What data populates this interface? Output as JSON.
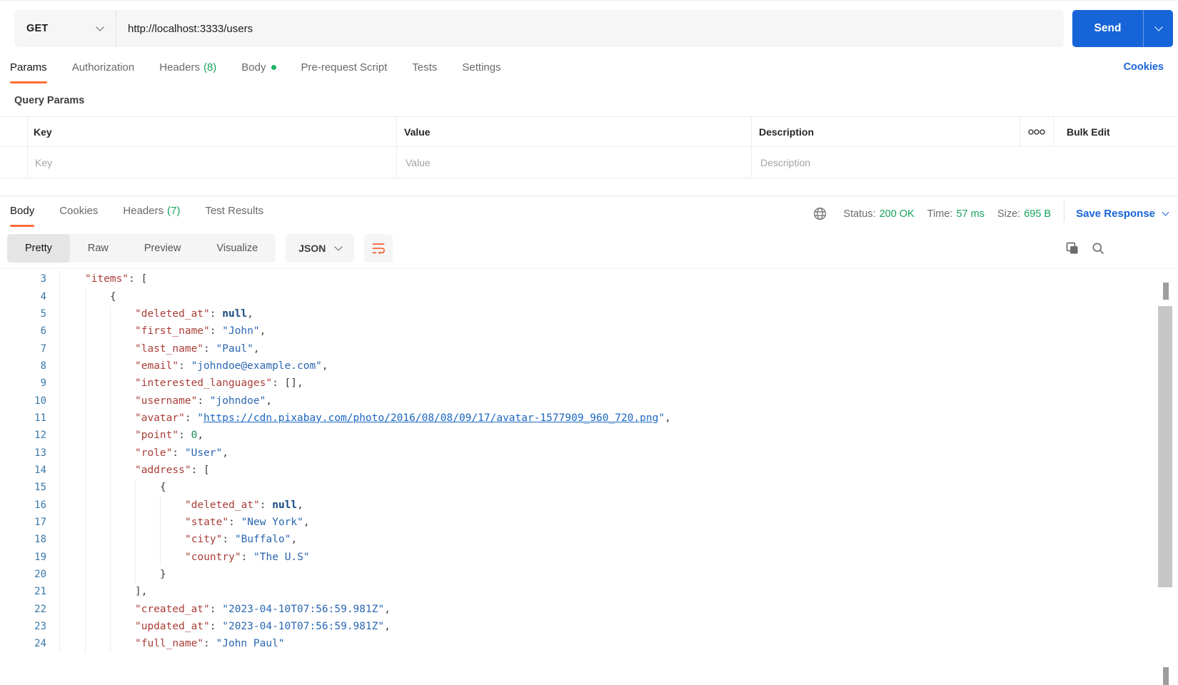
{
  "colors": {
    "accent_orange": "#ff6c37",
    "primary_blue": "#1764d8",
    "success_green": "#17a35c"
  },
  "request": {
    "method": "GET",
    "url": "http://localhost:3333/users",
    "send_label": "Send",
    "cookies_link": "Cookies",
    "tabs": [
      {
        "label": "Params",
        "active": true
      },
      {
        "label": "Authorization"
      },
      {
        "label": "Headers",
        "count": "(8)"
      },
      {
        "label": "Body",
        "dot": true
      },
      {
        "label": "Pre-request Script"
      },
      {
        "label": "Tests"
      },
      {
        "label": "Settings"
      }
    ]
  },
  "query_params": {
    "title": "Query Params",
    "columns": [
      "Key",
      "Value",
      "Description"
    ],
    "bulk_edit_label": "Bulk Edit",
    "placeholders": {
      "key": "Key",
      "value": "Value",
      "description": "Description"
    }
  },
  "response": {
    "tabs": [
      {
        "label": "Body",
        "active": true
      },
      {
        "label": "Cookies"
      },
      {
        "label": "Headers",
        "count": "(7)"
      },
      {
        "label": "Test Results"
      }
    ],
    "meta": {
      "status_label": "Status:",
      "status_value": "200 OK",
      "time_label": "Time:",
      "time_value": "57 ms",
      "size_label": "Size:",
      "size_value": "695 B"
    },
    "save_response_label": "Save Response",
    "view_modes": [
      {
        "label": "Pretty",
        "active": true
      },
      {
        "label": "Raw"
      },
      {
        "label": "Preview"
      },
      {
        "label": "Visualize"
      }
    ],
    "format_selector": "JSON"
  },
  "code": {
    "lines": [
      {
        "num": 3,
        "indent": 1,
        "tokens": [
          [
            "k",
            "\"items\""
          ],
          [
            "p",
            ": ["
          ]
        ]
      },
      {
        "num": 4,
        "indent": 2,
        "tokens": [
          [
            "p",
            "{"
          ]
        ]
      },
      {
        "num": 5,
        "indent": 3,
        "tokens": [
          [
            "k",
            "\"deleted_at\""
          ],
          [
            "p",
            ": "
          ],
          [
            "n",
            "null"
          ],
          [
            "p",
            ","
          ]
        ]
      },
      {
        "num": 6,
        "indent": 3,
        "tokens": [
          [
            "k",
            "\"first_name\""
          ],
          [
            "p",
            ": "
          ],
          [
            "s",
            "\"John\""
          ],
          [
            "p",
            ","
          ]
        ]
      },
      {
        "num": 7,
        "indent": 3,
        "tokens": [
          [
            "k",
            "\"last_name\""
          ],
          [
            "p",
            ": "
          ],
          [
            "s",
            "\"Paul\""
          ],
          [
            "p",
            ","
          ]
        ]
      },
      {
        "num": 8,
        "indent": 3,
        "tokens": [
          [
            "k",
            "\"email\""
          ],
          [
            "p",
            ": "
          ],
          [
            "s",
            "\"johndoe@example.com\""
          ],
          [
            "p",
            ","
          ]
        ]
      },
      {
        "num": 9,
        "indent": 3,
        "tokens": [
          [
            "k",
            "\"interested_languages\""
          ],
          [
            "p",
            ": [],"
          ]
        ]
      },
      {
        "num": 10,
        "indent": 3,
        "tokens": [
          [
            "k",
            "\"username\""
          ],
          [
            "p",
            ": "
          ],
          [
            "s",
            "\"johndoe\""
          ],
          [
            "p",
            ","
          ]
        ]
      },
      {
        "num": 11,
        "indent": 3,
        "tokens": [
          [
            "k",
            "\"avatar\""
          ],
          [
            "p",
            ": "
          ],
          [
            "s",
            "\""
          ],
          [
            "l",
            "https://cdn.pixabay.com/photo/2016/08/08/09/17/avatar-1577909_960_720.png"
          ],
          [
            "s",
            "\""
          ],
          [
            "p",
            ","
          ]
        ]
      },
      {
        "num": 12,
        "indent": 3,
        "tokens": [
          [
            "k",
            "\"point\""
          ],
          [
            "p",
            ": "
          ],
          [
            "g",
            "0"
          ],
          [
            "p",
            ","
          ]
        ]
      },
      {
        "num": 13,
        "indent": 3,
        "tokens": [
          [
            "k",
            "\"role\""
          ],
          [
            "p",
            ": "
          ],
          [
            "s",
            "\"User\""
          ],
          [
            "p",
            ","
          ]
        ]
      },
      {
        "num": 14,
        "indent": 3,
        "tokens": [
          [
            "k",
            "\"address\""
          ],
          [
            "p",
            ": ["
          ]
        ]
      },
      {
        "num": 15,
        "indent": 4,
        "tokens": [
          [
            "p",
            "{"
          ]
        ]
      },
      {
        "num": 16,
        "indent": 5,
        "tokens": [
          [
            "k",
            "\"deleted_at\""
          ],
          [
            "p",
            ": "
          ],
          [
            "n",
            "null"
          ],
          [
            "p",
            ","
          ]
        ]
      },
      {
        "num": 17,
        "indent": 5,
        "tokens": [
          [
            "k",
            "\"state\""
          ],
          [
            "p",
            ": "
          ],
          [
            "s",
            "\"New York\""
          ],
          [
            "p",
            ","
          ]
        ]
      },
      {
        "num": 18,
        "indent": 5,
        "tokens": [
          [
            "k",
            "\"city\""
          ],
          [
            "p",
            ": "
          ],
          [
            "s",
            "\"Buffalo\""
          ],
          [
            "p",
            ","
          ]
        ]
      },
      {
        "num": 19,
        "indent": 5,
        "tokens": [
          [
            "k",
            "\"country\""
          ],
          [
            "p",
            ": "
          ],
          [
            "s",
            "\"The U.S\""
          ]
        ]
      },
      {
        "num": 20,
        "indent": 4,
        "tokens": [
          [
            "p",
            "}"
          ]
        ]
      },
      {
        "num": 21,
        "indent": 3,
        "tokens": [
          [
            "p",
            "],"
          ]
        ]
      },
      {
        "num": 22,
        "indent": 3,
        "tokens": [
          [
            "k",
            "\"created_at\""
          ],
          [
            "p",
            ": "
          ],
          [
            "s",
            "\"2023-04-10T07:56:59.981Z\""
          ],
          [
            "p",
            ","
          ]
        ]
      },
      {
        "num": 23,
        "indent": 3,
        "tokens": [
          [
            "k",
            "\"updated_at\""
          ],
          [
            "p",
            ": "
          ],
          [
            "s",
            "\"2023-04-10T07:56:59.981Z\""
          ],
          [
            "p",
            ","
          ]
        ]
      },
      {
        "num": 24,
        "indent": 3,
        "tokens": [
          [
            "k",
            "\"full_name\""
          ],
          [
            "p",
            ": "
          ],
          [
            "s",
            "\"John Paul\""
          ]
        ]
      }
    ]
  }
}
